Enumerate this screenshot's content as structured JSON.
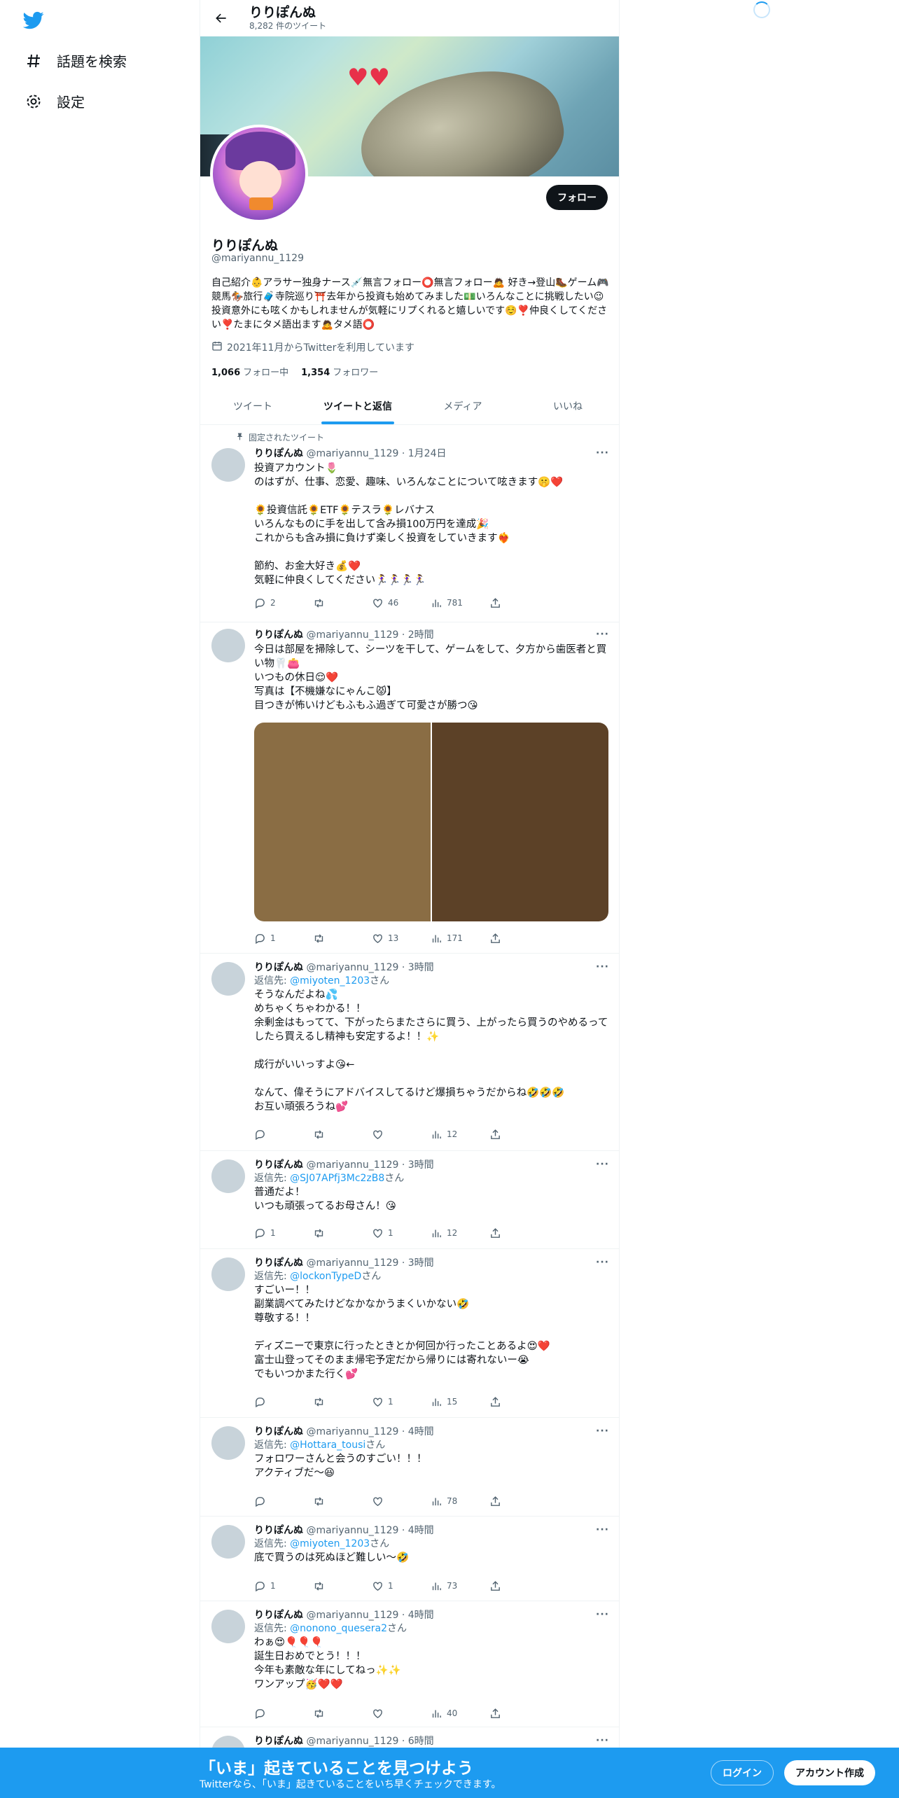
{
  "nav": {
    "explore": "話題を検索",
    "settings": "設定"
  },
  "header": {
    "name": "りりぽんぬ",
    "tweet_count": "8,282 件のツイート"
  },
  "profile": {
    "follow_label": "フォロー",
    "name": "りりぽんぬ",
    "handle": "@mariyannu_1129",
    "bio": "自己紹介👶アラサー独身ナース💉無言フォロー⭕無言フォロー🙇 好き→登山🥾ゲーム🎮競馬🏇旅行🧳寺院巡り⛩️去年から投資も始めてみました💵いろんなことに挑戦したい😉投資意外にも呟くかもしれませんが気軽にリプくれると嬉しいです☺️❣️仲良くしてください❣️たまにタメ語出ます🙇タメ語⭕",
    "joined": "2021年11月からTwitterを利用しています",
    "following_count": "1,066",
    "following_label": "フォロー中",
    "followers_count": "1,354",
    "followers_label": "フォロワー"
  },
  "tabs": [
    "ツイート",
    "ツイートと返信",
    "メディア",
    "いいね"
  ],
  "pinned_label": "固定されたツイート",
  "tweets": [
    {
      "name": "りりぽんぬ",
      "meta": "@mariyannu_1129 · 1月24日",
      "reply_to": "",
      "text": "投資アカウント🌷\nのはずが、仕事、恋愛、趣味、いろんなことについて呟きます🤫❤️\n\n🌻投資信託🌻ETF🌻テスラ🌻レバナス\nいろんなものに手を出して含み損100万円を達成🎉\nこれからも含み損に負けず楽しく投資をしていきます❤️‍🔥\n\n節約、お金大好き💰❤️\n気軽に仲良くしてください🏃‍♀️🏃‍♀️🏃‍♀️🏃‍♀️",
      "replies": "2",
      "retweets": "",
      "likes": "46",
      "views": "781"
    },
    {
      "name": "りりぽんぬ",
      "meta": "@mariyannu_1129 · 2時間",
      "reply_to": "",
      "text": "今日は部屋を掃除して、シーツを干して、ゲームをして、夕方から歯医者と買い物🦷👛\nいつもの休日😌❤️\n写真は【不機嫌なにゃんこ😾】\n目つきが怖いけどもふもふ過ぎて可愛さが勝つ😘",
      "replies": "1",
      "retweets": "",
      "likes": "13",
      "views": "171"
    },
    {
      "name": "りりぽんぬ",
      "meta": "@mariyannu_1129 · 3時間",
      "reply_prefix": "返信先: ",
      "reply_to": "@miyoten_1203",
      "reply_suffix": "さん",
      "text": "そうなんだよね💦\nめちゃくちゃわかる！！\n余剰金はもってて、下がったらまたさらに買う、上がったら買うのやめるってしたら買えるし精神も安定するよ！！✨\n\n成行がいいっすよ😘←\n\nなんて、偉そうにアドバイスしてるけど爆損ちゃうだからね🤣🤣🤣\nお互い頑張ろうね💕",
      "replies": "",
      "retweets": "",
      "likes": "",
      "views": "12"
    },
    {
      "name": "りりぽんぬ",
      "meta": "@mariyannu_1129 · 3時間",
      "reply_prefix": "返信先: ",
      "reply_to": "@SJ07APfj3Mc2zB8",
      "reply_suffix": "さん",
      "text": "普通だよ！\nいつも頑張ってるお母さん！😘",
      "replies": "1",
      "retweets": "",
      "likes": "1",
      "views": "12"
    },
    {
      "name": "りりぽんぬ",
      "meta": "@mariyannu_1129 · 3時間",
      "reply_prefix": "返信先: ",
      "reply_to": "@lockonTypeD",
      "reply_suffix": "さん",
      "text": "すごいー！！\n副業調べてみたけどなかなかうまくいかない🤣\n尊敬する！！\n\nディズニーで東京に行ったときとか何回か行ったことあるよ😍❤️\n富士山登ってそのまま帰宅予定だから帰りには寄れないー😭\nでもいつかまた行く💕",
      "replies": "",
      "retweets": "",
      "likes": "1",
      "views": "15"
    },
    {
      "name": "りりぽんぬ",
      "meta": "@mariyannu_1129 · 4時間",
      "reply_prefix": "返信先: ",
      "reply_to": "@Hottara_tousi",
      "reply_suffix": "さん",
      "text": "フォロワーさんと会うのすごい！！！\nアクティブだ〜😆",
      "replies": "",
      "retweets": "",
      "likes": "",
      "views": "78"
    },
    {
      "name": "りりぽんぬ",
      "meta": "@mariyannu_1129 · 4時間",
      "reply_prefix": "返信先: ",
      "reply_to": "@miyoten_1203",
      "reply_suffix": "さん",
      "text": "底で買うのは死ぬほど難しい〜🤣",
      "replies": "1",
      "retweets": "",
      "likes": "1",
      "views": "73"
    },
    {
      "name": "りりぽんぬ",
      "meta": "@mariyannu_1129 · 4時間",
      "reply_prefix": "返信先: ",
      "reply_to": "@nonono_quesera2",
      "reply_suffix": "さん",
      "text": "わぁ😍🎈🎈🎈\n誕生日おめでとう！！！\n今年も素敵な年にしてねっ✨✨\nワンアップ🥳❤️❤️",
      "replies": "",
      "retweets": "",
      "likes": "",
      "views": "40"
    },
    {
      "name": "りりぽんぬ",
      "meta": "@mariyannu_1129 · 6時間",
      "reply_to": "",
      "text": ""
    }
  ],
  "bottom_bar": {
    "title": "「いま」起きていることを見つけよう",
    "subtitle": "Twitterなら、「いま」起きていることをいち早くチェックできます。",
    "login": "ログイン",
    "signup": "アカウント作成"
  },
  "colors": {
    "accent": "#1d9bf0",
    "text": "#0f1419",
    "secondary": "#536471"
  }
}
